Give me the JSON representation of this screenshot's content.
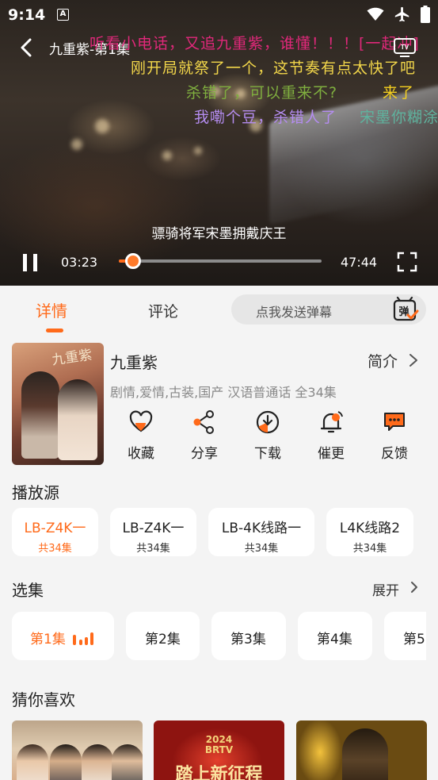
{
  "status_bar": {
    "time": "9:14",
    "sim_label": "A"
  },
  "player": {
    "title": "九重紫-第1集",
    "subtitle": "骠骑将军宋墨拥戴庆王",
    "current_time": "03:23",
    "total_time": "47:44",
    "progress_fraction": 0.071,
    "danmaku": [
      {
        "text": "听看小电话，又追九重紫，谁懂！！！[一起冲]",
        "color": "#e0287a"
      },
      {
        "text": "刚开局就祭了一个，这节奏有点太快了吧",
        "color": "#f2d64a"
      },
      {
        "text": "杀错了，可以重来不?",
        "color": "#7fae3f"
      },
      {
        "text": "来了",
        "color": "#f5d020"
      },
      {
        "text": "我嘞个豆，杀错人了",
        "color": "#b48cf0"
      },
      {
        "text": "宋墨你糊涂",
        "color": "#5fb39e"
      }
    ]
  },
  "tabs": {
    "detail": "详情",
    "comments": "评论",
    "danmu_placeholder": "点我发送弹幕",
    "danmu_icon_char": "弹"
  },
  "info": {
    "poster_text": "九重紫",
    "title": "九重紫",
    "brief_label": "简介",
    "meta": "剧情,爱情,古装,国产 汉语普通话 全34集",
    "actions": [
      {
        "label": "收藏",
        "icon": "heart-icon"
      },
      {
        "label": "分享",
        "icon": "share-icon"
      },
      {
        "label": "下载",
        "icon": "download-icon"
      },
      {
        "label": "催更",
        "icon": "bell-icon"
      },
      {
        "label": "反馈",
        "icon": "feedback-icon"
      }
    ]
  },
  "sources": {
    "heading": "播放源",
    "items": [
      {
        "name": "LB-Z4K一",
        "count": "共34集",
        "active": true
      },
      {
        "name": "LB-Z4K一",
        "count": "共34集",
        "active": false
      },
      {
        "name": "LB-4K线路一",
        "count": "共34集",
        "active": false
      },
      {
        "name": "L4K线路2",
        "count": "共34集",
        "active": false
      }
    ]
  },
  "episodes": {
    "heading": "选集",
    "expand_label": "展开",
    "items": [
      "第1集",
      "第2集",
      "第3集",
      "第4集",
      "第5"
    ],
    "active_index": 0
  },
  "recommend": {
    "heading": "猜你喜欢",
    "card2_year": "2024",
    "card2_brand": "BRTV",
    "card2_title": "踏上新征程"
  },
  "colors": {
    "accent": "#ff6a1a"
  }
}
